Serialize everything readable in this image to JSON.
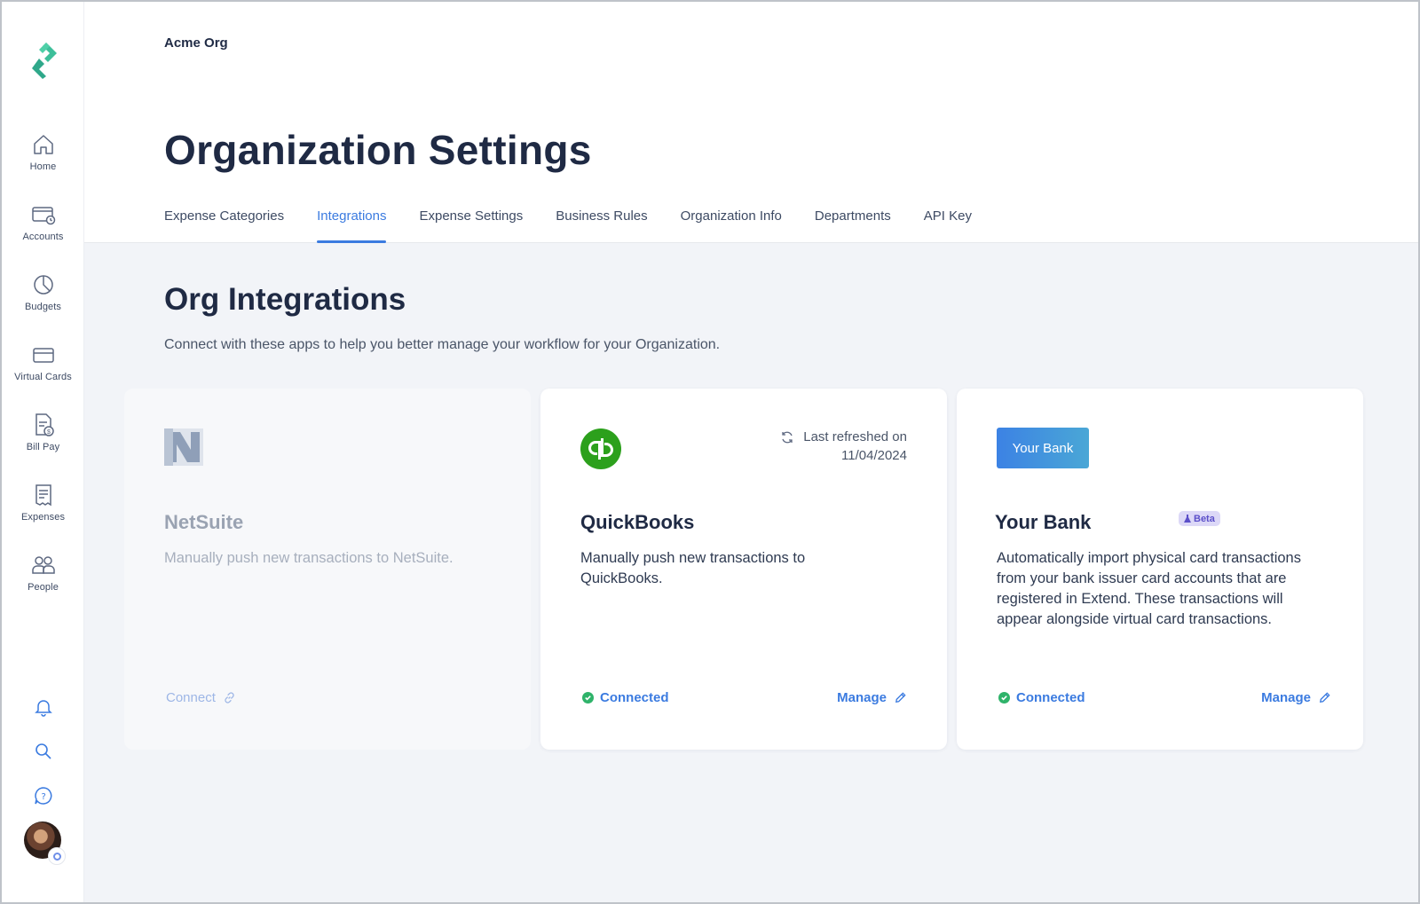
{
  "org_name": "Acme Org",
  "page_title": "Organization Settings",
  "sidebar": {
    "items": [
      {
        "label": "Home",
        "icon": "home-icon"
      },
      {
        "label": "Accounts",
        "icon": "accounts-icon"
      },
      {
        "label": "Budgets",
        "icon": "budgets-icon"
      },
      {
        "label": "Virtual Cards",
        "icon": "card-icon"
      },
      {
        "label": "Bill Pay",
        "icon": "bill-icon"
      },
      {
        "label": "Expenses",
        "icon": "receipt-icon"
      },
      {
        "label": "People",
        "icon": "people-icon"
      }
    ],
    "bottom_icons": [
      "bell-icon",
      "search-icon",
      "help-icon"
    ]
  },
  "tabs": [
    {
      "label": "Expense Categories",
      "active": false
    },
    {
      "label": "Integrations",
      "active": true
    },
    {
      "label": "Expense Settings",
      "active": false
    },
    {
      "label": "Business Rules",
      "active": false
    },
    {
      "label": "Organization Info",
      "active": false
    },
    {
      "label": "Departments",
      "active": false
    },
    {
      "label": "API Key",
      "active": false
    }
  ],
  "section": {
    "title": "Org Integrations",
    "description": "Connect with these apps to help you better manage your workflow for your Organization."
  },
  "cards": {
    "netsuite": {
      "title": "NetSuite",
      "description": "Manually push new transactions to NetSuite.",
      "action_label": "Connect"
    },
    "quickbooks": {
      "title": "QuickBooks",
      "description": "Manually push new transactions to QuickBooks.",
      "refresh_label": "Last refreshed on",
      "refresh_date": "11/04/2024",
      "status_label": "Connected",
      "manage_label": "Manage"
    },
    "yourbank": {
      "logo_text": "Your Bank",
      "title": "Your Bank",
      "badge": "Beta",
      "description": "Automatically import physical card transactions from your bank issuer card accounts that are registered in Extend. These transactions will appear alongside virtual card transactions.",
      "status_label": "Connected",
      "manage_label": "Manage"
    }
  },
  "colors": {
    "accent": "#3b7be0",
    "connected": "#2fb36a",
    "quickbooks_green": "#2ca01c",
    "logo_teal": "#3dbf9a"
  }
}
